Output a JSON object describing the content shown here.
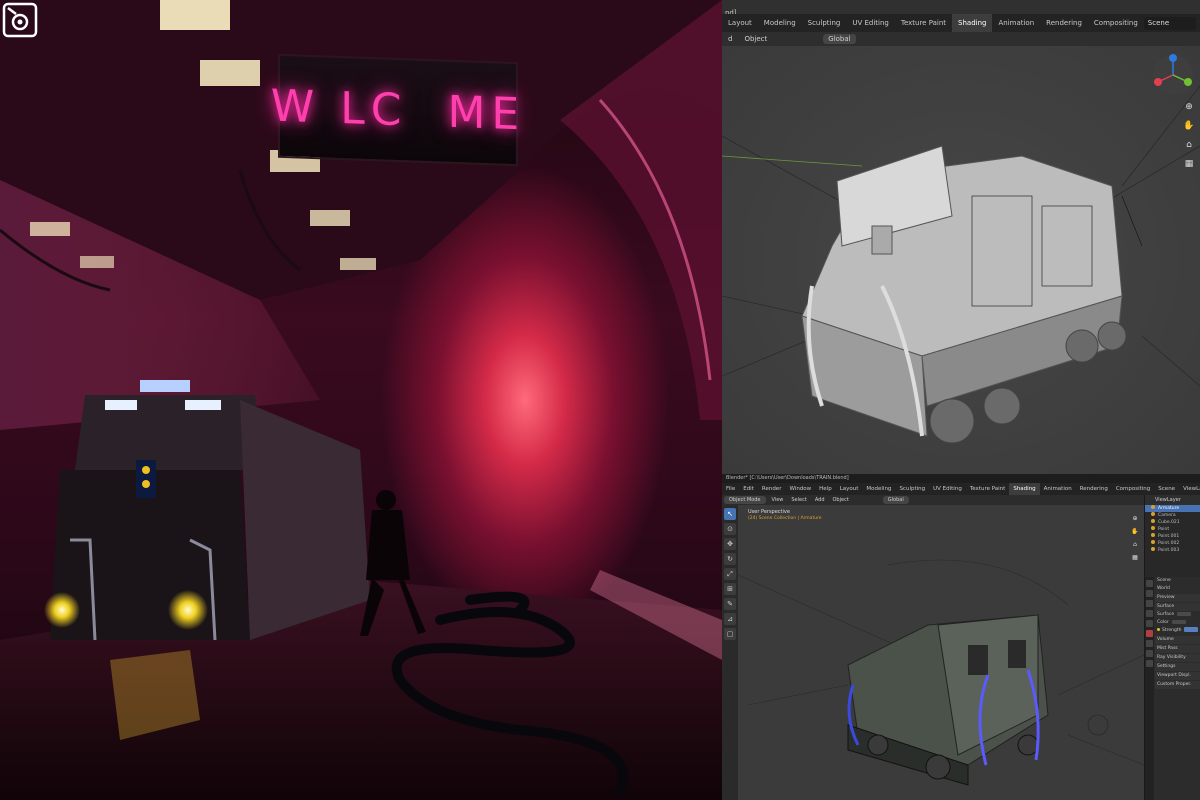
{
  "render": {
    "sign_text": "W LC  ME",
    "logo": "stylized-eye-logo-icon"
  },
  "blender_top": {
    "title": "nd]",
    "tabs": [
      "Layout",
      "Modeling",
      "Sculpting",
      "UV Editing",
      "Texture Paint",
      "Shading",
      "Animation",
      "Rendering",
      "Compositing"
    ],
    "active_tab": "Shading",
    "scene": "Scene",
    "header": {
      "left": "d",
      "object_menu": "Object",
      "transform_orientation": "Global"
    }
  },
  "blender_bottom": {
    "window_title": "Blender* [C:\\Users\\User\\Downloads\\TRAIN.blend]",
    "menu": [
      "File",
      "Edit",
      "Render",
      "Window",
      "Help"
    ],
    "tabs": [
      "Layout",
      "Modeling",
      "Sculpting",
      "UV Editing",
      "Texture Paint",
      "Shading",
      "Animation",
      "Rendering",
      "Compositing"
    ],
    "active_tab": "Shading",
    "scene": "Scene",
    "view_layer": "ViewLayer",
    "header": {
      "mode": "Object Mode",
      "view": "View",
      "select": "Select",
      "add": "Add",
      "object": "Object",
      "orientation": "Global"
    },
    "viewport_label": "User Perspective",
    "viewport_sub": "(24) Scene Collection | Armature",
    "outliner": [
      {
        "label": "Armature",
        "selected": true
      },
      {
        "label": "Camera",
        "selected": false
      },
      {
        "label": "Cube.021",
        "selected": false
      },
      {
        "label": "Point",
        "selected": false
      },
      {
        "label": "Point.001",
        "selected": false
      },
      {
        "label": "Point.002",
        "selected": false
      },
      {
        "label": "Point.003",
        "selected": false
      }
    ],
    "properties": {
      "scene": "Scene",
      "world": "World",
      "rows": [
        "Preview",
        "Surface",
        "Surface",
        "Color",
        "Strength",
        "Volume",
        "Mist Pass",
        "Ray Visibility",
        "Settings",
        "Viewport Displ.",
        "Custom Proper."
      ]
    }
  },
  "colors": {
    "neon_pink": "#ff3fae",
    "blender_active": "#4772b3",
    "tunnel_red": "#d42a48"
  }
}
